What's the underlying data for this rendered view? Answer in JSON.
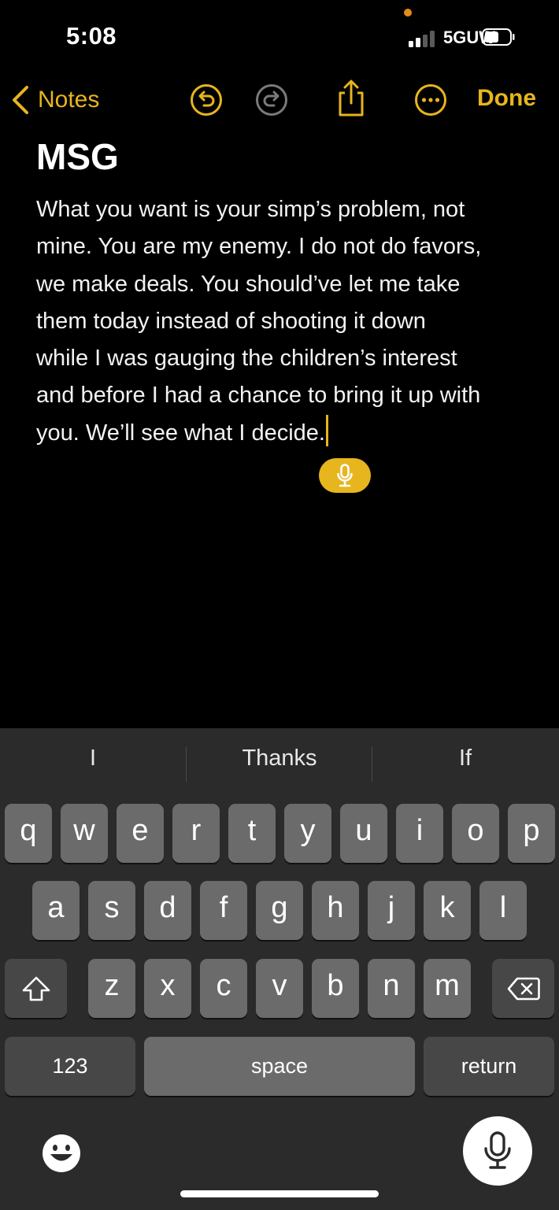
{
  "status_bar": {
    "time": "5:08",
    "network": "5GUW"
  },
  "nav": {
    "back_label": "Notes",
    "done_label": "Done"
  },
  "note": {
    "title": "MSG",
    "body_lines": [
      "What you want is your simp’s problem, not",
      "mine. You are my enemy. I do not do favors,",
      "we make deals. You should’ve let me take",
      "them today instead of shooting it down",
      "while I was gauging the children’s interest",
      "and before I had a chance to bring it up with",
      "you. We’ll see what I decide."
    ]
  },
  "keyboard": {
    "suggestions": [
      "I",
      "Thanks",
      "If"
    ],
    "row1": [
      "q",
      "w",
      "e",
      "r",
      "t",
      "y",
      "u",
      "i",
      "o",
      "p"
    ],
    "row2": [
      "a",
      "s",
      "d",
      "f",
      "g",
      "h",
      "j",
      "k",
      "l"
    ],
    "row3": [
      "z",
      "x",
      "c",
      "v",
      "b",
      "n",
      "m"
    ],
    "numbers_label": "123",
    "space_label": "space",
    "return_label": "return"
  },
  "colors": {
    "accent": "#e7b51d",
    "background": "#000000",
    "keyboard_bg": "#2b2b2b",
    "key": "#6b6b6b",
    "modifier_key": "#474747"
  },
  "icons": {
    "back": "chevron-left-icon",
    "undo": "undo-icon",
    "redo": "redo-icon",
    "share": "share-icon",
    "more": "ellipsis-circle-icon",
    "dictation": "microphone-icon",
    "shift": "shift-icon",
    "delete": "delete-backward-icon",
    "emoji": "emoji-icon"
  }
}
